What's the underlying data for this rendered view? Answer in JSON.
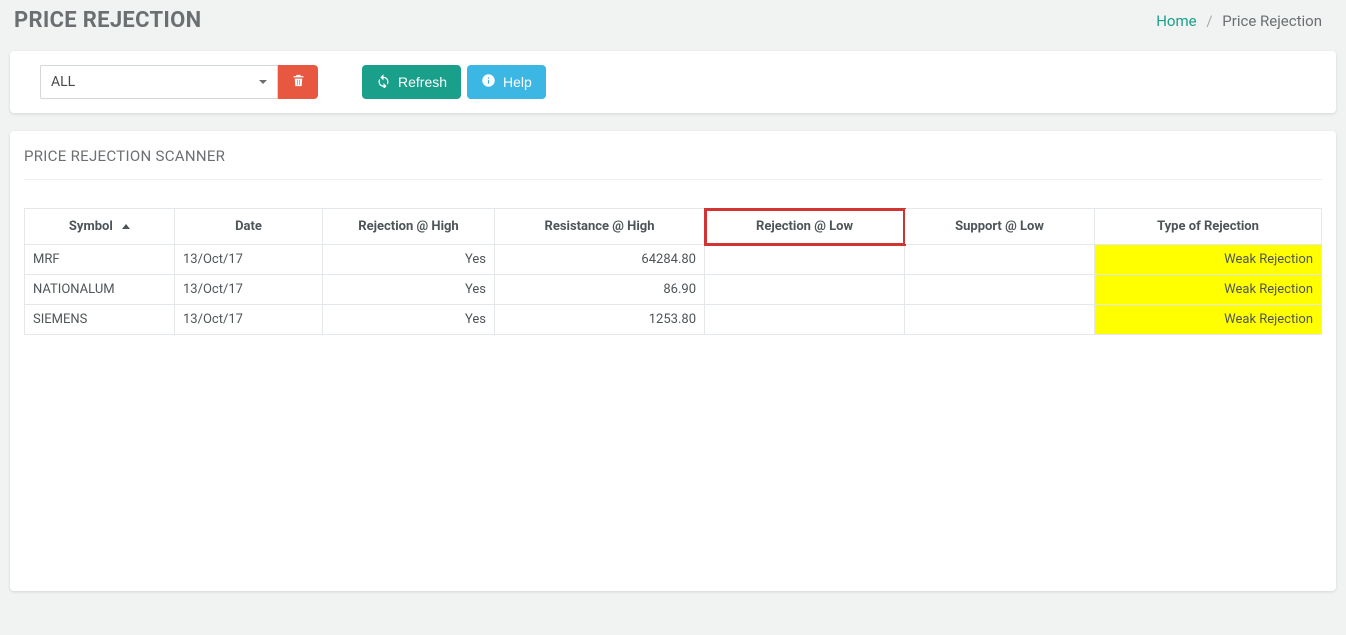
{
  "header": {
    "title": "PRICE REJECTION",
    "breadcrumb": {
      "home": "Home",
      "current": "Price Rejection"
    }
  },
  "toolbar": {
    "filter_selected": "ALL",
    "refresh_label": "Refresh",
    "help_label": "Help"
  },
  "scanner": {
    "title": "PRICE REJECTION SCANNER",
    "columns": {
      "symbol": "Symbol",
      "date": "Date",
      "rej_high": "Rejection @ High",
      "res_high": "Resistance @ High",
      "rej_low": "Rejection @ Low",
      "sup_low": "Support @ Low",
      "type": "Type of Rejection"
    },
    "rows": [
      {
        "symbol": "MRF",
        "date": "13/Oct/17",
        "rej_high": "Yes",
        "res_high": "64284.80",
        "rej_low": "",
        "sup_low": "",
        "type": "Weak Rejection"
      },
      {
        "symbol": "NATIONALUM",
        "date": "13/Oct/17",
        "rej_high": "Yes",
        "res_high": "86.90",
        "rej_low": "",
        "sup_low": "",
        "type": "Weak Rejection"
      },
      {
        "symbol": "SIEMENS",
        "date": "13/Oct/17",
        "rej_high": "Yes",
        "res_high": "1253.80",
        "rej_low": "",
        "sup_low": "",
        "type": "Weak Rejection"
      }
    ]
  }
}
